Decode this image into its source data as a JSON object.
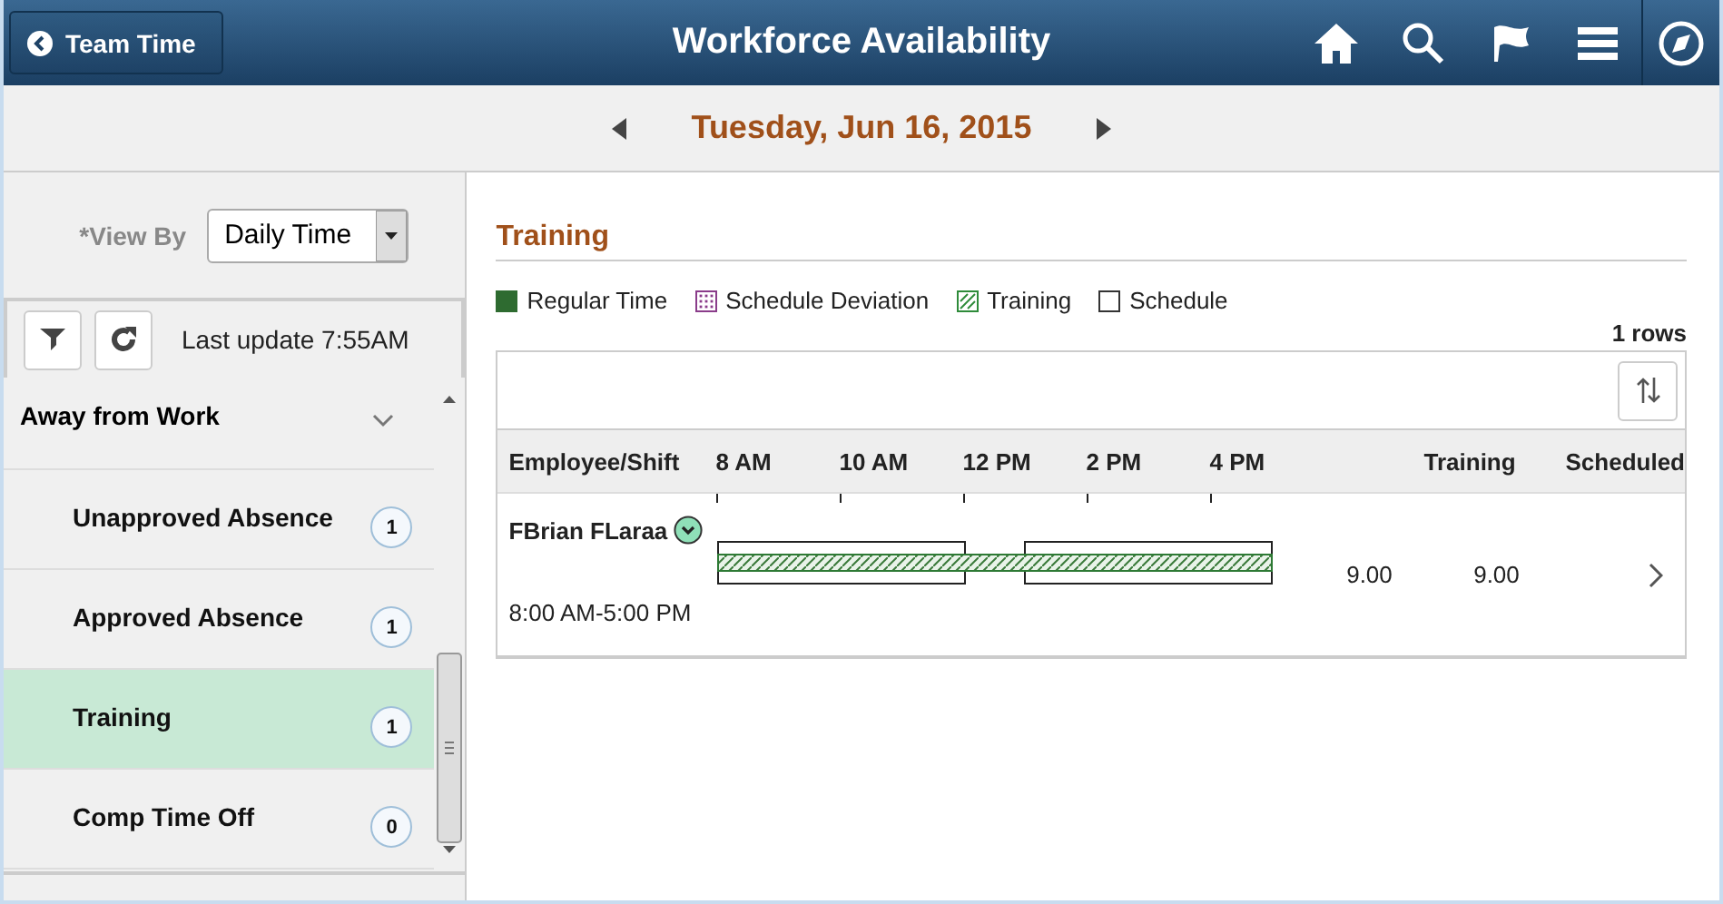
{
  "header": {
    "back_button": "Team Time",
    "title": "Workforce Availability"
  },
  "date_bar": {
    "date": "Tuesday, Jun 16, 2015"
  },
  "sidebar": {
    "view_by": {
      "label": "*View By",
      "value": "Daily Time"
    },
    "last_update": "Last update 7:55AM",
    "group": {
      "label": "Away from Work",
      "expanded": true
    },
    "items": [
      {
        "label": "Unapproved Absence",
        "count": "1",
        "selected": false
      },
      {
        "label": "Approved Absence",
        "count": "1",
        "selected": false
      },
      {
        "label": "Training",
        "count": "1",
        "selected": true
      },
      {
        "label": "Comp Time Off",
        "count": "0",
        "selected": false
      }
    ]
  },
  "main": {
    "section_title": "Training",
    "legend": [
      {
        "kind": "solid",
        "label": "Regular Time",
        "color": "#2e6b30"
      },
      {
        "kind": "dotted",
        "label": "Schedule Deviation",
        "color": "#8a3c8a"
      },
      {
        "kind": "hatched",
        "label": "Training",
        "color": "#2e8b3a"
      },
      {
        "kind": "empty",
        "label": "Schedule",
        "color": "#333333"
      }
    ],
    "row_count": "1 rows",
    "columns": [
      "Employee/Shift",
      "8 AM",
      "10 AM",
      "12 PM",
      "2 PM",
      "4 PM",
      "Training",
      "Scheduled"
    ],
    "rows": [
      {
        "name": "FBrian FLaraa",
        "shift": "8:00 AM-5:00 PM",
        "training": "9.00",
        "scheduled": "9.00"
      }
    ]
  }
}
